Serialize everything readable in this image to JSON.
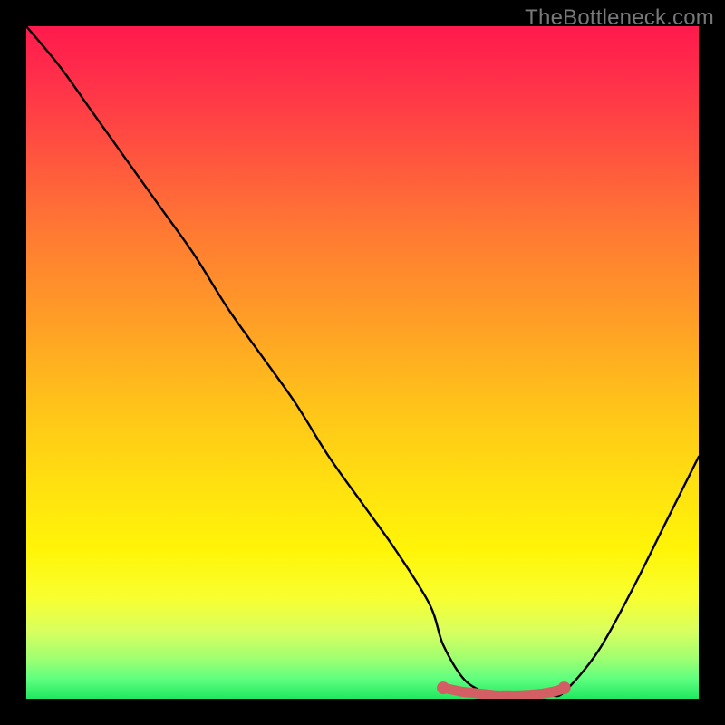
{
  "watermark": "TheBottleneck.com",
  "chart_data": {
    "type": "line",
    "title": "",
    "xlabel": "",
    "ylabel": "",
    "xlim": [
      0,
      100
    ],
    "ylim": [
      0,
      100
    ],
    "series": [
      {
        "name": "bottleneck-curve",
        "color": "#000000",
        "x": [
          0,
          5,
          10,
          15,
          20,
          25,
          30,
          35,
          40,
          45,
          50,
          55,
          60,
          62,
          65,
          68,
          70,
          72,
          74,
          76,
          78,
          80,
          85,
          90,
          95,
          100
        ],
        "values": [
          100,
          94,
          87,
          80,
          73,
          66,
          58,
          51,
          44,
          36,
          29,
          22,
          14,
          8,
          3,
          1,
          0.5,
          0.4,
          0.3,
          0.3,
          0.5,
          1,
          7,
          16,
          26,
          36
        ]
      },
      {
        "name": "optimal-marker",
        "type": "marker",
        "color": "#d35e63",
        "x": [
          62,
          64,
          65,
          67,
          69,
          70,
          71,
          72,
          73,
          75,
          77,
          79,
          80
        ],
        "values": [
          1.6,
          1.2,
          1.0,
          0.8,
          0.6,
          0.5,
          0.5,
          0.5,
          0.5,
          0.6,
          0.8,
          1.2,
          1.6
        ]
      }
    ],
    "gradient_stops": [
      {
        "pos": 0,
        "color": "#ff1a4d"
      },
      {
        "pos": 50,
        "color": "#ffb020"
      },
      {
        "pos": 85,
        "color": "#fff508"
      },
      {
        "pos": 100,
        "color": "#20e860"
      }
    ]
  }
}
